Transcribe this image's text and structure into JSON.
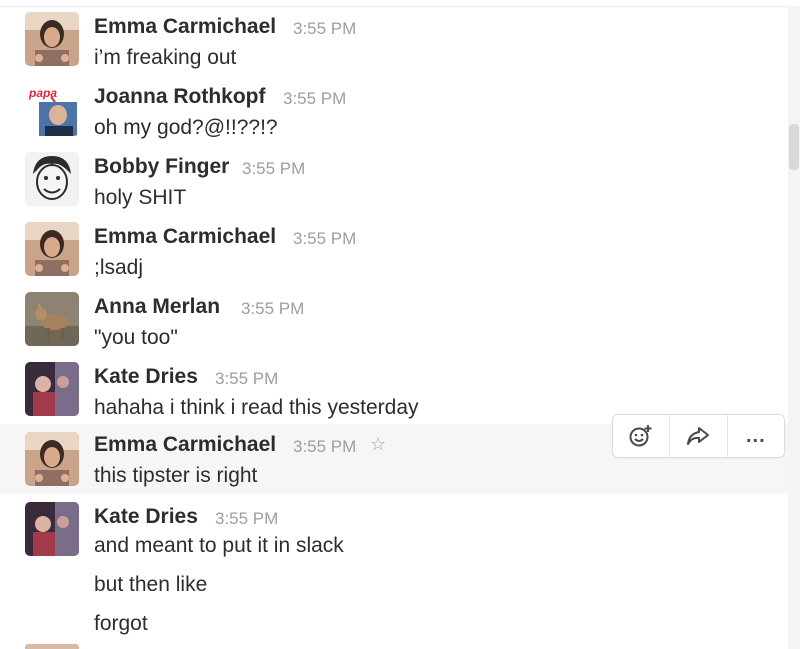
{
  "messages": [
    {
      "author": "Emma Carmichael",
      "time": "3:55 PM",
      "lines": [
        "i’m freaking out"
      ]
    },
    {
      "author": "Joanna Rothkopf",
      "time": "3:55 PM",
      "lines": [
        "oh my god?@!!??!?"
      ],
      "avatar_tag": "papa"
    },
    {
      "author": "Bobby Finger",
      "time": "3:55 PM",
      "lines": [
        "holy SHIT"
      ]
    },
    {
      "author": "Emma Carmichael",
      "time": "3:55 PM",
      "lines": [
        ";lsadj"
      ]
    },
    {
      "author": "Anna Merlan",
      "time": "3:55 PM",
      "lines": [
        "\"you too\""
      ]
    },
    {
      "author": "Kate Dries",
      "time": "3:55 PM",
      "lines": [
        "hahaha i think i read this yesterday"
      ]
    },
    {
      "author": "Emma Carmichael",
      "time": "3:55 PM",
      "lines": [
        "this tipster is right"
      ],
      "hovered": true
    },
    {
      "author": "Kate Dries",
      "time": "3:55 PM",
      "lines": [
        "and meant to put it in slack",
        "but then like",
        "forgot"
      ]
    }
  ],
  "message_actions": [
    {
      "icon": "add-reaction-icon"
    },
    {
      "icon": "share-icon"
    },
    {
      "icon": "more-actions-icon",
      "label": "..."
    }
  ],
  "colors": {
    "text": "#2c2d30",
    "timestamp": "#9d9ea1",
    "hover_row": "#f6f6f6",
    "papa_tag": "#e0283a"
  }
}
